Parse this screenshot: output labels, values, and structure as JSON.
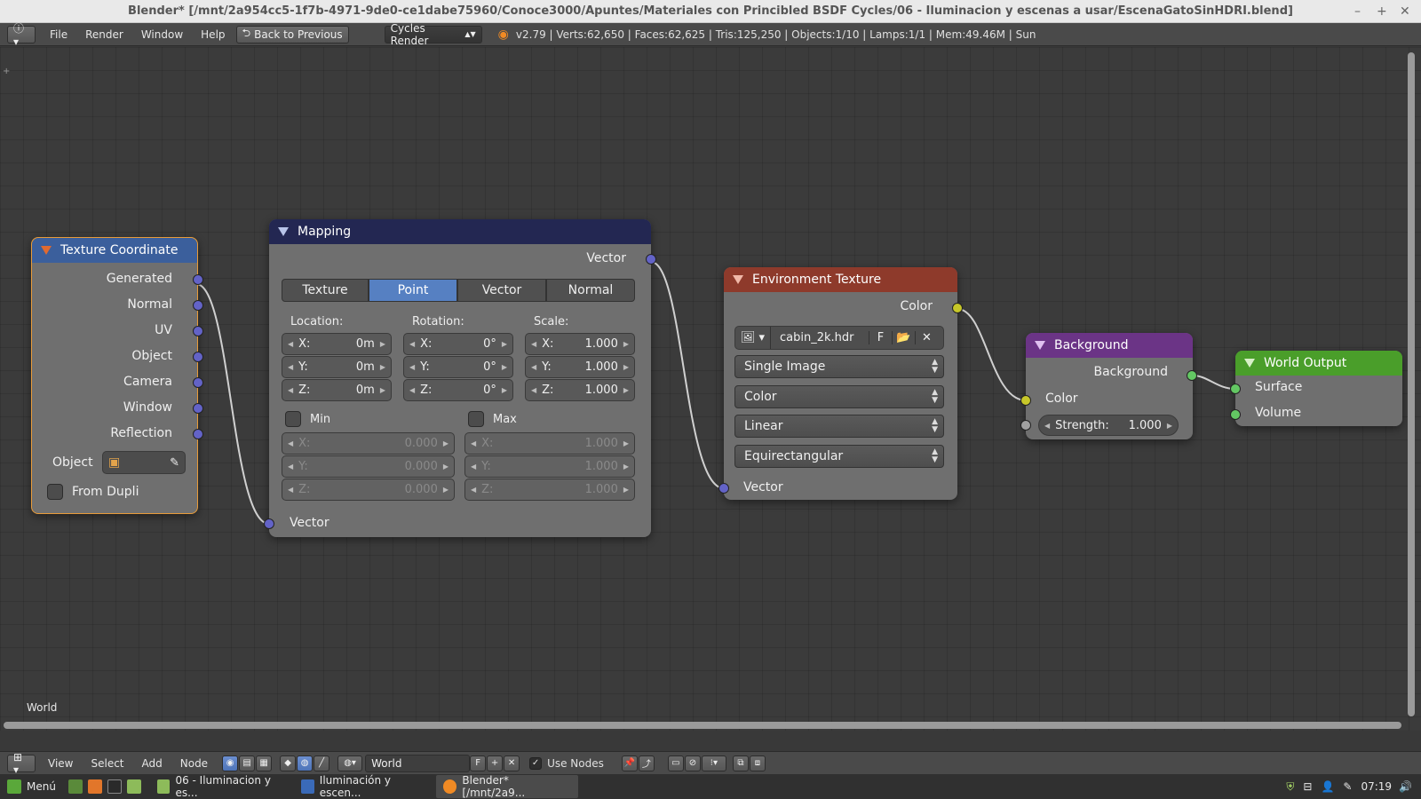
{
  "window": {
    "title": "Blender* [/mnt/2a954cc5-1f7b-4971-9de0-ce1dabe75960/Conoce3000/Apuntes/Materiales con Princibled BSDF Cycles/06 - Iluminacion y escenas a usar/EscenaGatoSinHDRI.blend]"
  },
  "info_header": {
    "menus": [
      "File",
      "Render",
      "Window",
      "Help"
    ],
    "back_button": "Back to Previous",
    "engine": "Cycles Render",
    "stats": "v2.79 | Verts:62,650 | Faces:62,625 | Tris:125,250 | Objects:1/10 | Lamps:1/1 | Mem:49.46M | Sun"
  },
  "nodes": {
    "texcoord": {
      "title": "Texture Coordinate",
      "outputs": [
        "Generated",
        "Normal",
        "UV",
        "Object",
        "Camera",
        "Window",
        "Reflection"
      ],
      "object_label": "Object",
      "from_dupli": "From Dupli"
    },
    "mapping": {
      "title": "Mapping",
      "output": "Vector",
      "tabs": [
        "Texture",
        "Point",
        "Vector",
        "Normal"
      ],
      "active_tab": "Point",
      "location_label": "Location:",
      "rotation_label": "Rotation:",
      "scale_label": "Scale:",
      "location": [
        {
          "axis": "X:",
          "value": "0m"
        },
        {
          "axis": "Y:",
          "value": "0m"
        },
        {
          "axis": "Z:",
          "value": "0m"
        }
      ],
      "rotation": [
        {
          "axis": "X:",
          "value": "0°"
        },
        {
          "axis": "Y:",
          "value": "0°"
        },
        {
          "axis": "Z:",
          "value": "0°"
        }
      ],
      "scale": [
        {
          "axis": "X:",
          "value": "1.000"
        },
        {
          "axis": "Y:",
          "value": "1.000"
        },
        {
          "axis": "Z:",
          "value": "1.000"
        }
      ],
      "min_label": "Min",
      "max_label": "Max",
      "min": [
        {
          "axis": "X:",
          "value": "0.000"
        },
        {
          "axis": "Y:",
          "value": "0.000"
        },
        {
          "axis": "Z:",
          "value": "0.000"
        }
      ],
      "max": [
        {
          "axis": "X:",
          "value": "1.000"
        },
        {
          "axis": "Y:",
          "value": "1.000"
        },
        {
          "axis": "Z:",
          "value": "1.000"
        }
      ],
      "input": "Vector"
    },
    "envtex": {
      "title": "Environment Texture",
      "output": "Color",
      "image_name": "cabin_2k.hdr",
      "fake_user": "F",
      "source": "Single Image",
      "color_space": "Color",
      "interpolation": "Linear",
      "projection": "Equirectangular",
      "input": "Vector"
    },
    "background": {
      "title": "Background",
      "output": "Background",
      "color_input": "Color",
      "strength_label": "Strength:",
      "strength_value": "1.000"
    },
    "world_output": {
      "title": "World Output",
      "inputs": [
        "Surface",
        "Volume"
      ]
    }
  },
  "editor": {
    "context_label": "World",
    "menus": [
      "View",
      "Select",
      "Add",
      "Node"
    ],
    "world_name": "World",
    "fake_user": "F",
    "use_nodes": "Use Nodes"
  },
  "taskbar": {
    "menu": "Menú",
    "tasks": [
      "06 - Iluminacion y es...",
      "Iluminación y escen...",
      "Blender* [/mnt/2a9..."
    ],
    "clock": "07:19"
  },
  "colors": {
    "texcoord_header": "#3b5f9c",
    "mapping_header": "#232752",
    "envtex_header": "#8e3a2b",
    "background_header": "#6b3486",
    "world_output_header": "#4a9e2a",
    "socket_vector": "#6363c7",
    "socket_color": "#c7c729",
    "socket_shader": "#63c763",
    "active_tab": "#5680c2"
  }
}
